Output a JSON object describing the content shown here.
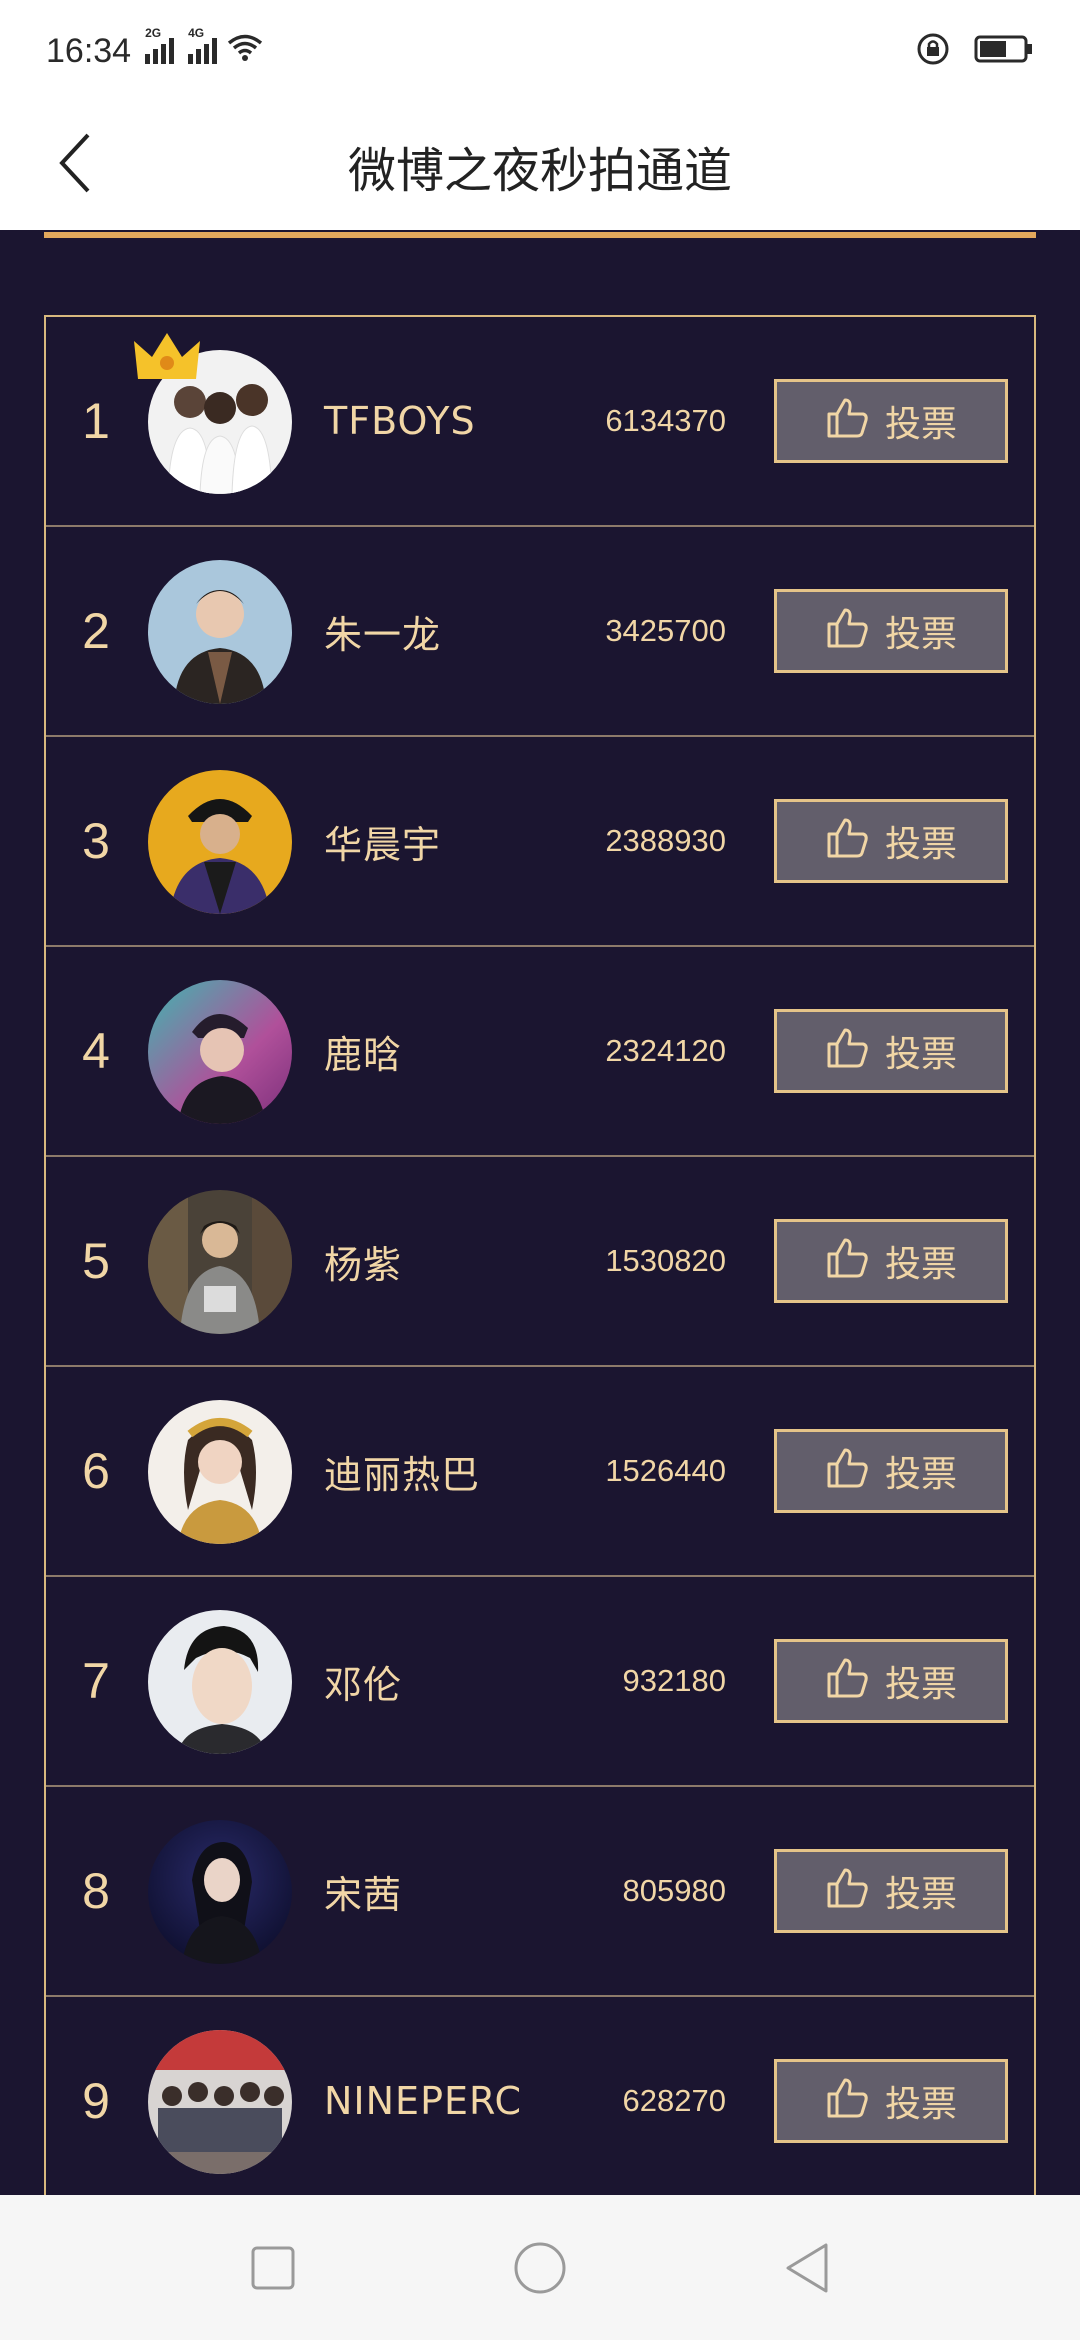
{
  "status_bar": {
    "time": "16:34",
    "signal1_label": "2G",
    "signal2_label": "4G",
    "icons": [
      "signal-icon",
      "signal-icon",
      "wifi-icon",
      "rotation-lock-icon",
      "battery-icon"
    ]
  },
  "header": {
    "title": "微博之夜秒拍通道",
    "back_icon": "back-chevron-icon"
  },
  "accent_colors": {
    "gold": "#e2a85c",
    "text": "#f1d6a6",
    "background": "#1b1530",
    "button_bg": "#625e6b"
  },
  "ranking": [
    {
      "rank": "1",
      "name": "TFBOYS",
      "votes": "6134370",
      "button_label": "投票",
      "crown": true
    },
    {
      "rank": "2",
      "name": "朱一龙",
      "votes": "3425700",
      "button_label": "投票"
    },
    {
      "rank": "3",
      "name": "华晨宇",
      "votes": "2388930",
      "button_label": "投票"
    },
    {
      "rank": "4",
      "name": "鹿晗",
      "votes": "2324120",
      "button_label": "投票"
    },
    {
      "rank": "5",
      "name": "杨紫",
      "votes": "1530820",
      "button_label": "投票"
    },
    {
      "rank": "6",
      "name": "迪丽热巴",
      "votes": "1526440",
      "button_label": "投票"
    },
    {
      "rank": "7",
      "name": "邓伦",
      "votes": "932180",
      "button_label": "投票"
    },
    {
      "rank": "8",
      "name": "宋茜",
      "votes": "805980",
      "button_label": "投票"
    },
    {
      "rank": "9",
      "name": "NINEPERC",
      "votes": "628270",
      "button_label": "投票"
    }
  ],
  "nav_bar": {
    "icons": [
      "recents-square-icon",
      "home-circle-icon",
      "back-triangle-icon"
    ]
  }
}
